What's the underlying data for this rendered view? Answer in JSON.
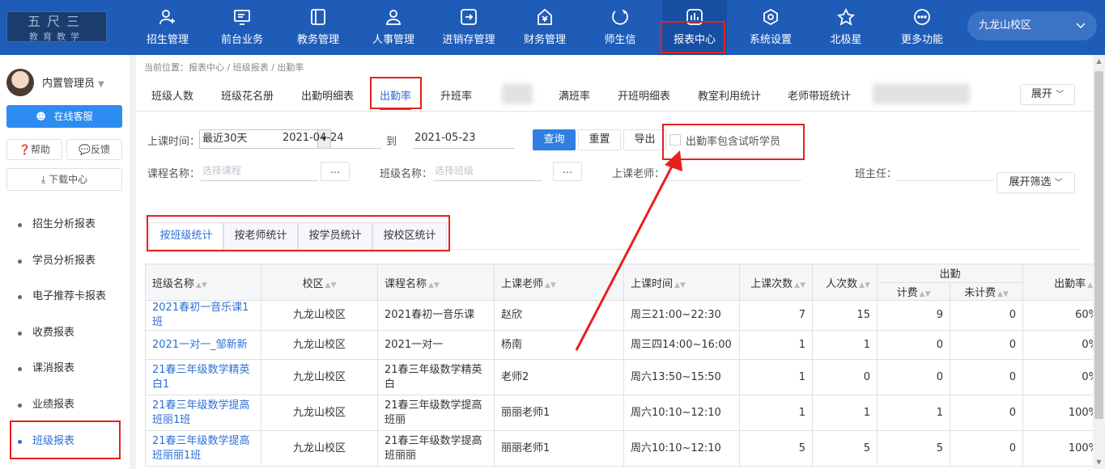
{
  "topnav": {
    "logo_top": "五尺三",
    "logo_bottom": "教育教学",
    "items": [
      {
        "label": "招生管理",
        "icon": "add-user-icon"
      },
      {
        "label": "前台业务",
        "icon": "monitor-icon"
      },
      {
        "label": "教务管理",
        "icon": "book-icon"
      },
      {
        "label": "人事管理",
        "icon": "person-icon"
      },
      {
        "label": "进销存管理",
        "icon": "inventory-icon"
      },
      {
        "label": "财务管理",
        "icon": "finance-icon"
      },
      {
        "label": "师生信",
        "icon": "chat-icon"
      },
      {
        "label": "报表中心",
        "icon": "chart-icon"
      },
      {
        "label": "系统设置",
        "icon": "gear-icon"
      },
      {
        "label": "北极星",
        "icon": "star-icon"
      },
      {
        "label": "更多功能",
        "icon": "more-icon"
      }
    ],
    "campus": "九龙山校区"
  },
  "sidebar": {
    "username": "内置管理员",
    "service_button": "在线客服",
    "help_button": "帮助",
    "feedback_button": "反馈",
    "download_button": "下载中心",
    "menu": [
      "招生分析报表",
      "学员分析报表",
      "电子推荐卡报表",
      "收费报表",
      "课消报表",
      "业绩报表",
      "班级报表"
    ],
    "active_menu": "班级报表"
  },
  "breadcrumb": "当前位置：报表中心 / 班级报表 / 出勤率",
  "tabs": {
    "items": [
      "班级人数",
      "班级花名册",
      "出勤明细表",
      "出勤率",
      "升班率",
      "满班率",
      "开班明细表",
      "教室利用统计",
      "老师带班统计"
    ],
    "active": "出勤率",
    "expand": "展开"
  },
  "filters": {
    "class_time_label": "上课时间：",
    "range_value": "最近30天",
    "start_date": "2021-04-24",
    "to_label": "到",
    "end_date": "2021-05-23",
    "query_button": "查询",
    "reset_button": "重置",
    "export_button": "导出",
    "include_trial_label": "出勤率包含试听学员",
    "course_label": "课程名称：",
    "course_placeholder": "选择课程",
    "class_label": "班级名称：",
    "class_placeholder": "选择班级",
    "teacher_label": "上课老师：",
    "head_teacher_label": "班主任：",
    "dots": "...",
    "expand_filter": "展开筛选"
  },
  "stat_tabs": {
    "items": [
      "按班级统计",
      "按老师统计",
      "按学员统计",
      "按校区统计"
    ],
    "active": "按班级统计"
  },
  "table": {
    "headers": {
      "class_name": "班级名称",
      "campus": "校区",
      "course_name": "课程名称",
      "teacher": "上课老师",
      "class_time": "上课时间",
      "sessions": "上课次数",
      "person_times": "人次数",
      "attendance": "出勤",
      "billed": "计费",
      "unbilled": "未计费",
      "rate": "出勤率"
    },
    "rows": [
      {
        "class_name": "2021春初一音乐课1班",
        "campus": "九龙山校区",
        "course_name": "2021春初一音乐课",
        "teacher": "赵欣",
        "class_time": "周三21:00~22:30",
        "sessions": "7",
        "person_times": "15",
        "billed": "9",
        "unbilled": "0",
        "rate": "60%"
      },
      {
        "class_name": "2021一对一_邹新新",
        "campus": "九龙山校区",
        "course_name": "2021一对一",
        "teacher": "杨南",
        "class_time": "周三四14:00~16:00",
        "sessions": "1",
        "person_times": "1",
        "billed": "0",
        "unbilled": "0",
        "rate": "0%"
      },
      {
        "class_name": "21春三年级数学精英白1",
        "campus": "九龙山校区",
        "course_name": "21春三年级数学精英白",
        "teacher": "老师2",
        "class_time": "周六13:50~15:50",
        "sessions": "1",
        "person_times": "0",
        "billed": "0",
        "unbilled": "0",
        "rate": "0%"
      },
      {
        "class_name": "21春三年级数学提高班丽1班",
        "campus": "九龙山校区",
        "course_name": "21春三年级数学提高班丽",
        "teacher": "丽丽老师1",
        "class_time": "周六10:10~12:10",
        "sessions": "1",
        "person_times": "1",
        "billed": "1",
        "unbilled": "0",
        "rate": "100%"
      },
      {
        "class_name": "21春三年级数学提高班丽丽1班",
        "campus": "九龙山校区",
        "course_name": "21春三年级数学提高班丽丽",
        "teacher": "丽丽老师1",
        "class_time": "周六10:10~12:10",
        "sessions": "5",
        "person_times": "5",
        "billed": "5",
        "unbilled": "0",
        "rate": "100%"
      }
    ]
  },
  "colors": {
    "nav_bg": "#1f5cb8",
    "accent": "#2d6fd6",
    "annotation_red": "#e8201c"
  }
}
